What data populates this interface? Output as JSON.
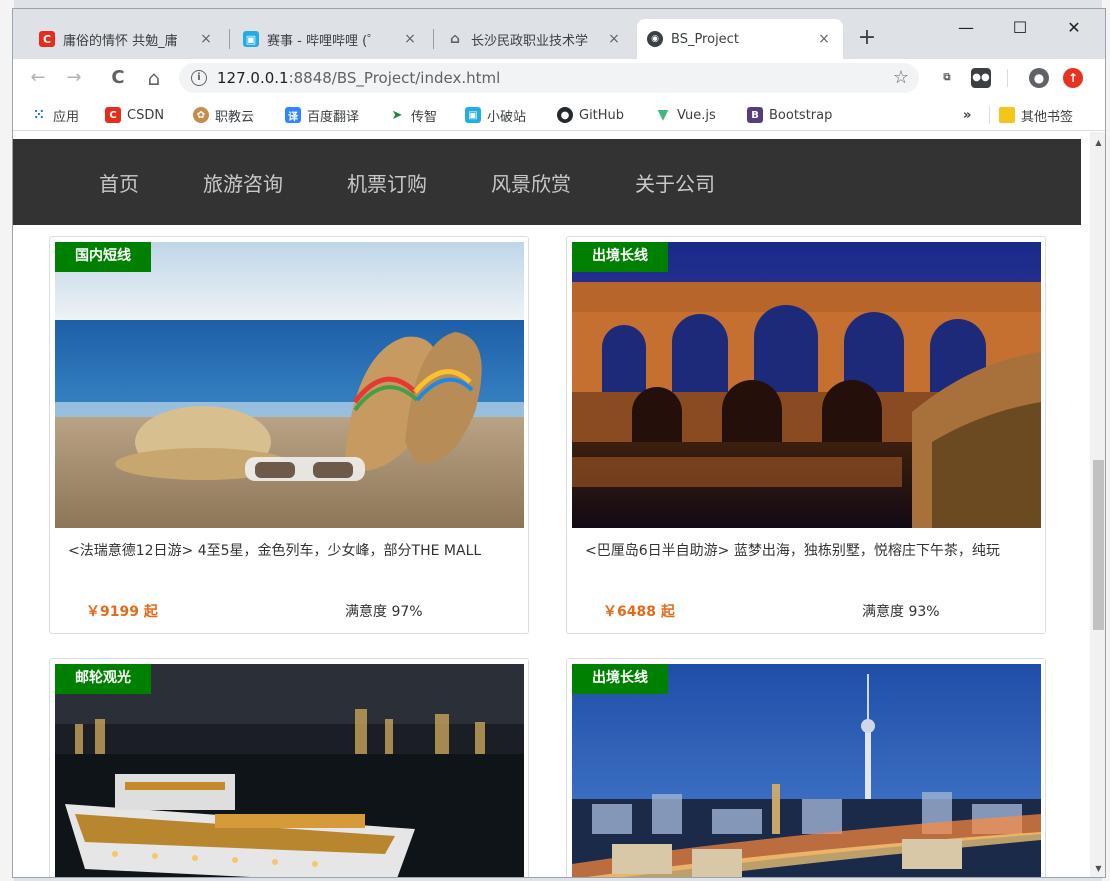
{
  "browser": {
    "tabs": [
      {
        "title": "庸俗的情怀 共勉_庸",
        "close": "×"
      },
      {
        "title": "赛事 - 哔哩哔哩 (゜",
        "close": "×"
      },
      {
        "title": "长沙民政职业技术学",
        "close": "×"
      },
      {
        "title": "BS_Project",
        "close": "×"
      }
    ],
    "new_tab": "+",
    "window_controls": {
      "minimize": "—",
      "maximize": "☐",
      "close": "✕"
    },
    "url_host": "127.0.0.1",
    "url_path": ":8848/BS_Project/index.html",
    "bookmarks": [
      "应用",
      "CSDN",
      "职教云",
      "百度翻译",
      "传智",
      "小破站",
      "GitHub",
      "Vue.js",
      "Bootstrap"
    ],
    "bookmarks_more": "»",
    "other_bookmarks": "其他书签",
    "colors": {
      "csdn": "#e42d1c",
      "bili": "#23ade5",
      "github": "#24292e",
      "vue": "#41b883",
      "bootstrap": "#563d7c"
    }
  },
  "nav": {
    "items": [
      "首页",
      "旅游咨询",
      "机票订购",
      "风景欣赏",
      "关于公司"
    ]
  },
  "cards": [
    {
      "tag": "国内短线",
      "desc": "<法瑞意德12日游> 4至5星，金色列车，少女峰，部分THE MALL",
      "price": "￥9199 起",
      "satisfaction": "满意度 97%"
    },
    {
      "tag": "出境长线",
      "desc": "<巴厘岛6日半自助游> 蓝梦出海，独栋别墅，悦榕庄下午茶，纯玩",
      "price": "￥6488 起",
      "satisfaction": "满意度 93%"
    },
    {
      "tag": "邮轮观光"
    },
    {
      "tag": "出境长线"
    }
  ],
  "accent_color": "#008000",
  "price_color": "#e46a1a"
}
